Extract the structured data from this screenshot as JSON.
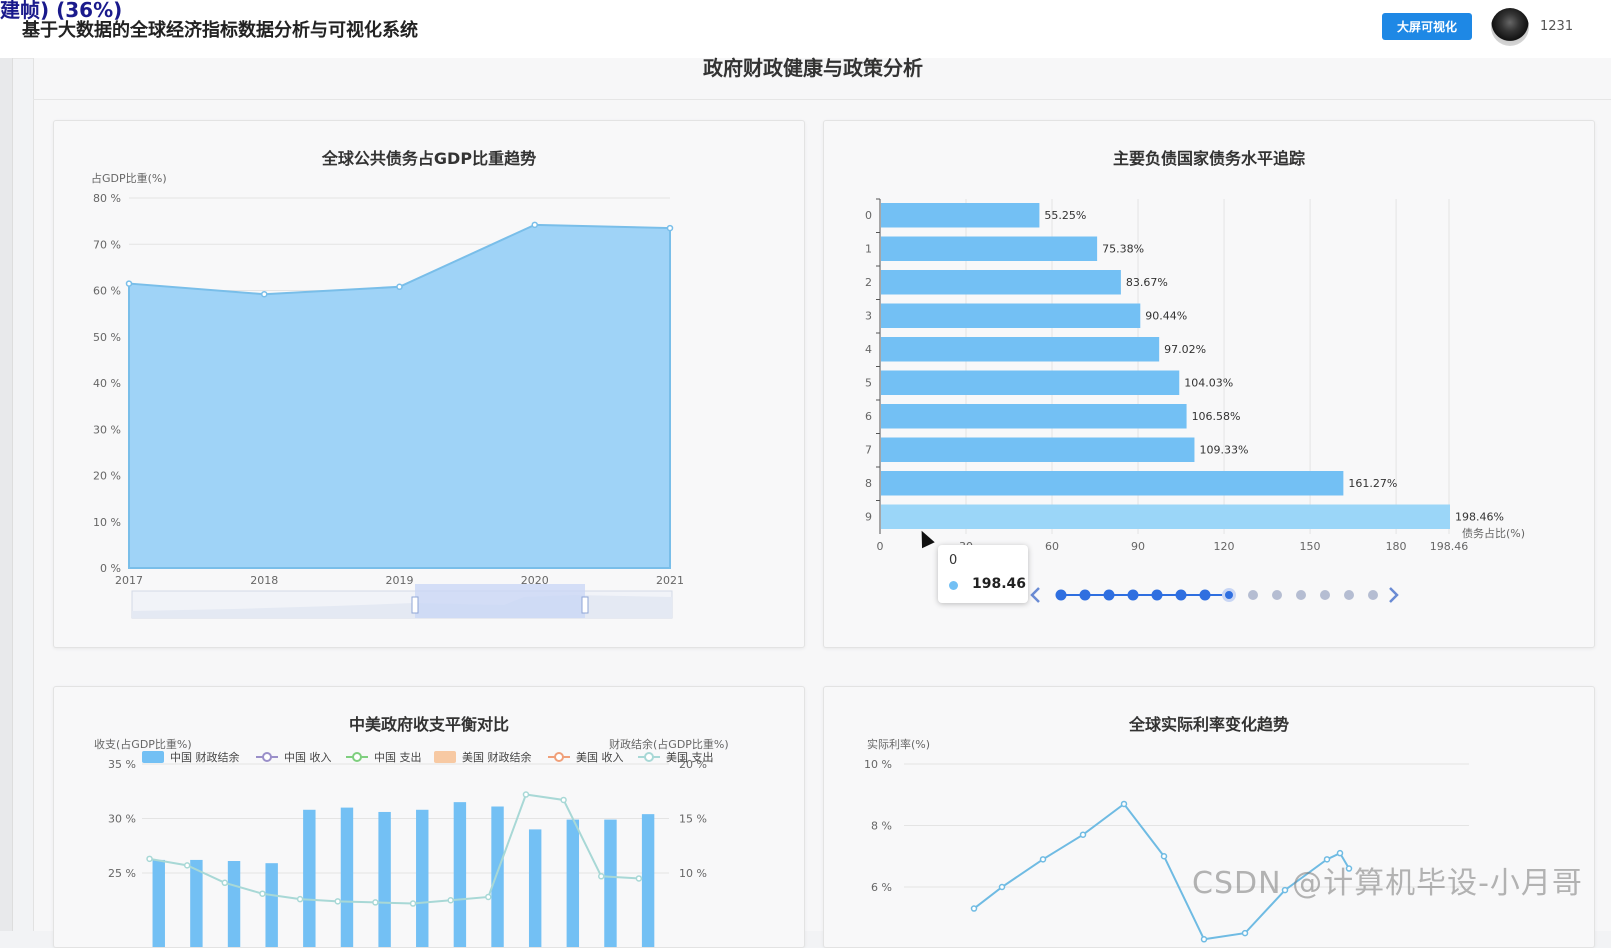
{
  "app": {
    "overlay_text": "建帧) (36%)",
    "system_title": "基于大数据的全球经济指标数据分析与可视化系统",
    "bigscreen_button": "大屏可视化",
    "username": "1231"
  },
  "page": {
    "title": "政府财政健康与政策分析"
  },
  "charts": {
    "debt_trend": {
      "title": "全球公共债务占GDP比重趋势",
      "ylabel": "占GDP比重(%)",
      "y_ticks": [
        "80 %",
        "70 %",
        "60 %",
        "50 %",
        "40 %",
        "30 %",
        "20 %",
        "10 %",
        "0 %"
      ],
      "x_ticks": [
        "2017",
        "2018",
        "2019",
        "2020",
        "2021"
      ]
    },
    "debt_countries": {
      "title": "主要负债国家债务水平追踪",
      "xlabel": "债务占比(%)",
      "y_ticks": [
        "0",
        "1",
        "2",
        "3",
        "4",
        "5",
        "6",
        "7",
        "8",
        "9"
      ],
      "x_ticks": [
        "0",
        "30",
        "60",
        "90",
        "120",
        "150",
        "180",
        "198.46"
      ],
      "value_labels": [
        "55.25%",
        "75.38%",
        "83.67%",
        "90.44%",
        "97.02%",
        "104.03%",
        "106.58%",
        "109.33%",
        "161.27%",
        "198.46%"
      ]
    },
    "cn_us_balance": {
      "title": "中美政府收支平衡对比",
      "left_axis_label": "收支(占GDP比重%)",
      "right_axis_label": "财政结余(占GDP比重%)",
      "left_ticks": [
        "35 %",
        "30 %",
        "25 %"
      ],
      "right_ticks": [
        "20 %",
        "15 %",
        "10 %"
      ],
      "legend": [
        "中国 财政结余",
        "中国 收入",
        "中国 支出",
        "美国 财政结余",
        "美国 收入",
        "美国 支出"
      ]
    },
    "real_rate": {
      "title": "全球实际利率变化趋势",
      "ylabel": "实际利率(%)",
      "y_ticks": [
        "10 %",
        "8 %",
        "6 %"
      ]
    }
  },
  "tooltip": {
    "category": "0",
    "value": "198.46"
  },
  "watermark": "CSDN @计算机毕设-小月哥",
  "chart_data": [
    {
      "type": "area",
      "title": "全球公共债务占GDP比重趋势",
      "ylabel": "占GDP比重(%)",
      "x": [
        "2017",
        "2018",
        "2019",
        "2020",
        "2021"
      ],
      "values": [
        61.5,
        59.2,
        60.8,
        74.2,
        73.5
      ],
      "ylim": [
        0,
        80
      ],
      "color": "#9fd3f7",
      "grid": true
    },
    {
      "type": "bar",
      "orientation": "horizontal",
      "title": "主要负债国家债务水平追踪",
      "xlabel": "债务占比(%)",
      "categories": [
        "0",
        "1",
        "2",
        "3",
        "4",
        "5",
        "6",
        "7",
        "8",
        "9"
      ],
      "values": [
        55.25,
        75.38,
        83.67,
        90.44,
        97.02,
        104.03,
        106.58,
        109.33,
        161.27,
        198.46
      ],
      "xlim": [
        0,
        198.46
      ],
      "color": "#73c0f4",
      "highlight_color": "#9bd6f8",
      "grid": true
    },
    {
      "type": "bar",
      "title": "中美政府收支平衡对比",
      "legend_placement": "top",
      "series": [
        {
          "name": "中国 财政结余",
          "kind": "bar",
          "axis": "left",
          "color": "#73c0f4",
          "values": [
            26.2,
            26.2,
            26.1,
            25.9,
            30.8,
            31.0,
            30.6,
            30.8,
            31.5,
            31.1,
            29.0,
            29.9,
            29.9,
            30.4
          ]
        },
        {
          "name": "美国 支出",
          "kind": "line",
          "axis": "right",
          "color": "#a8d8d6",
          "values": [
            11.3,
            10.7,
            9.1,
            8.1,
            7.6,
            7.4,
            7.3,
            7.2,
            7.5,
            7.8,
            17.2,
            16.7,
            9.7,
            9.5
          ]
        }
      ],
      "left_ylim": [
        25,
        35
      ],
      "right_ylim": [
        10,
        20
      ]
    },
    {
      "type": "line",
      "title": "全球实际利率变化趋势",
      "ylabel": "实际利率(%)",
      "ylim": [
        6,
        10
      ],
      "series": [
        {
          "name": "",
          "color": "#6fbbe3",
          "values": [
            5.3,
            6.0,
            6.9,
            7.7,
            8.7,
            7.0,
            4.3,
            4.5,
            5.9,
            6.9,
            7.1,
            6.6
          ]
        }
      ]
    }
  ]
}
